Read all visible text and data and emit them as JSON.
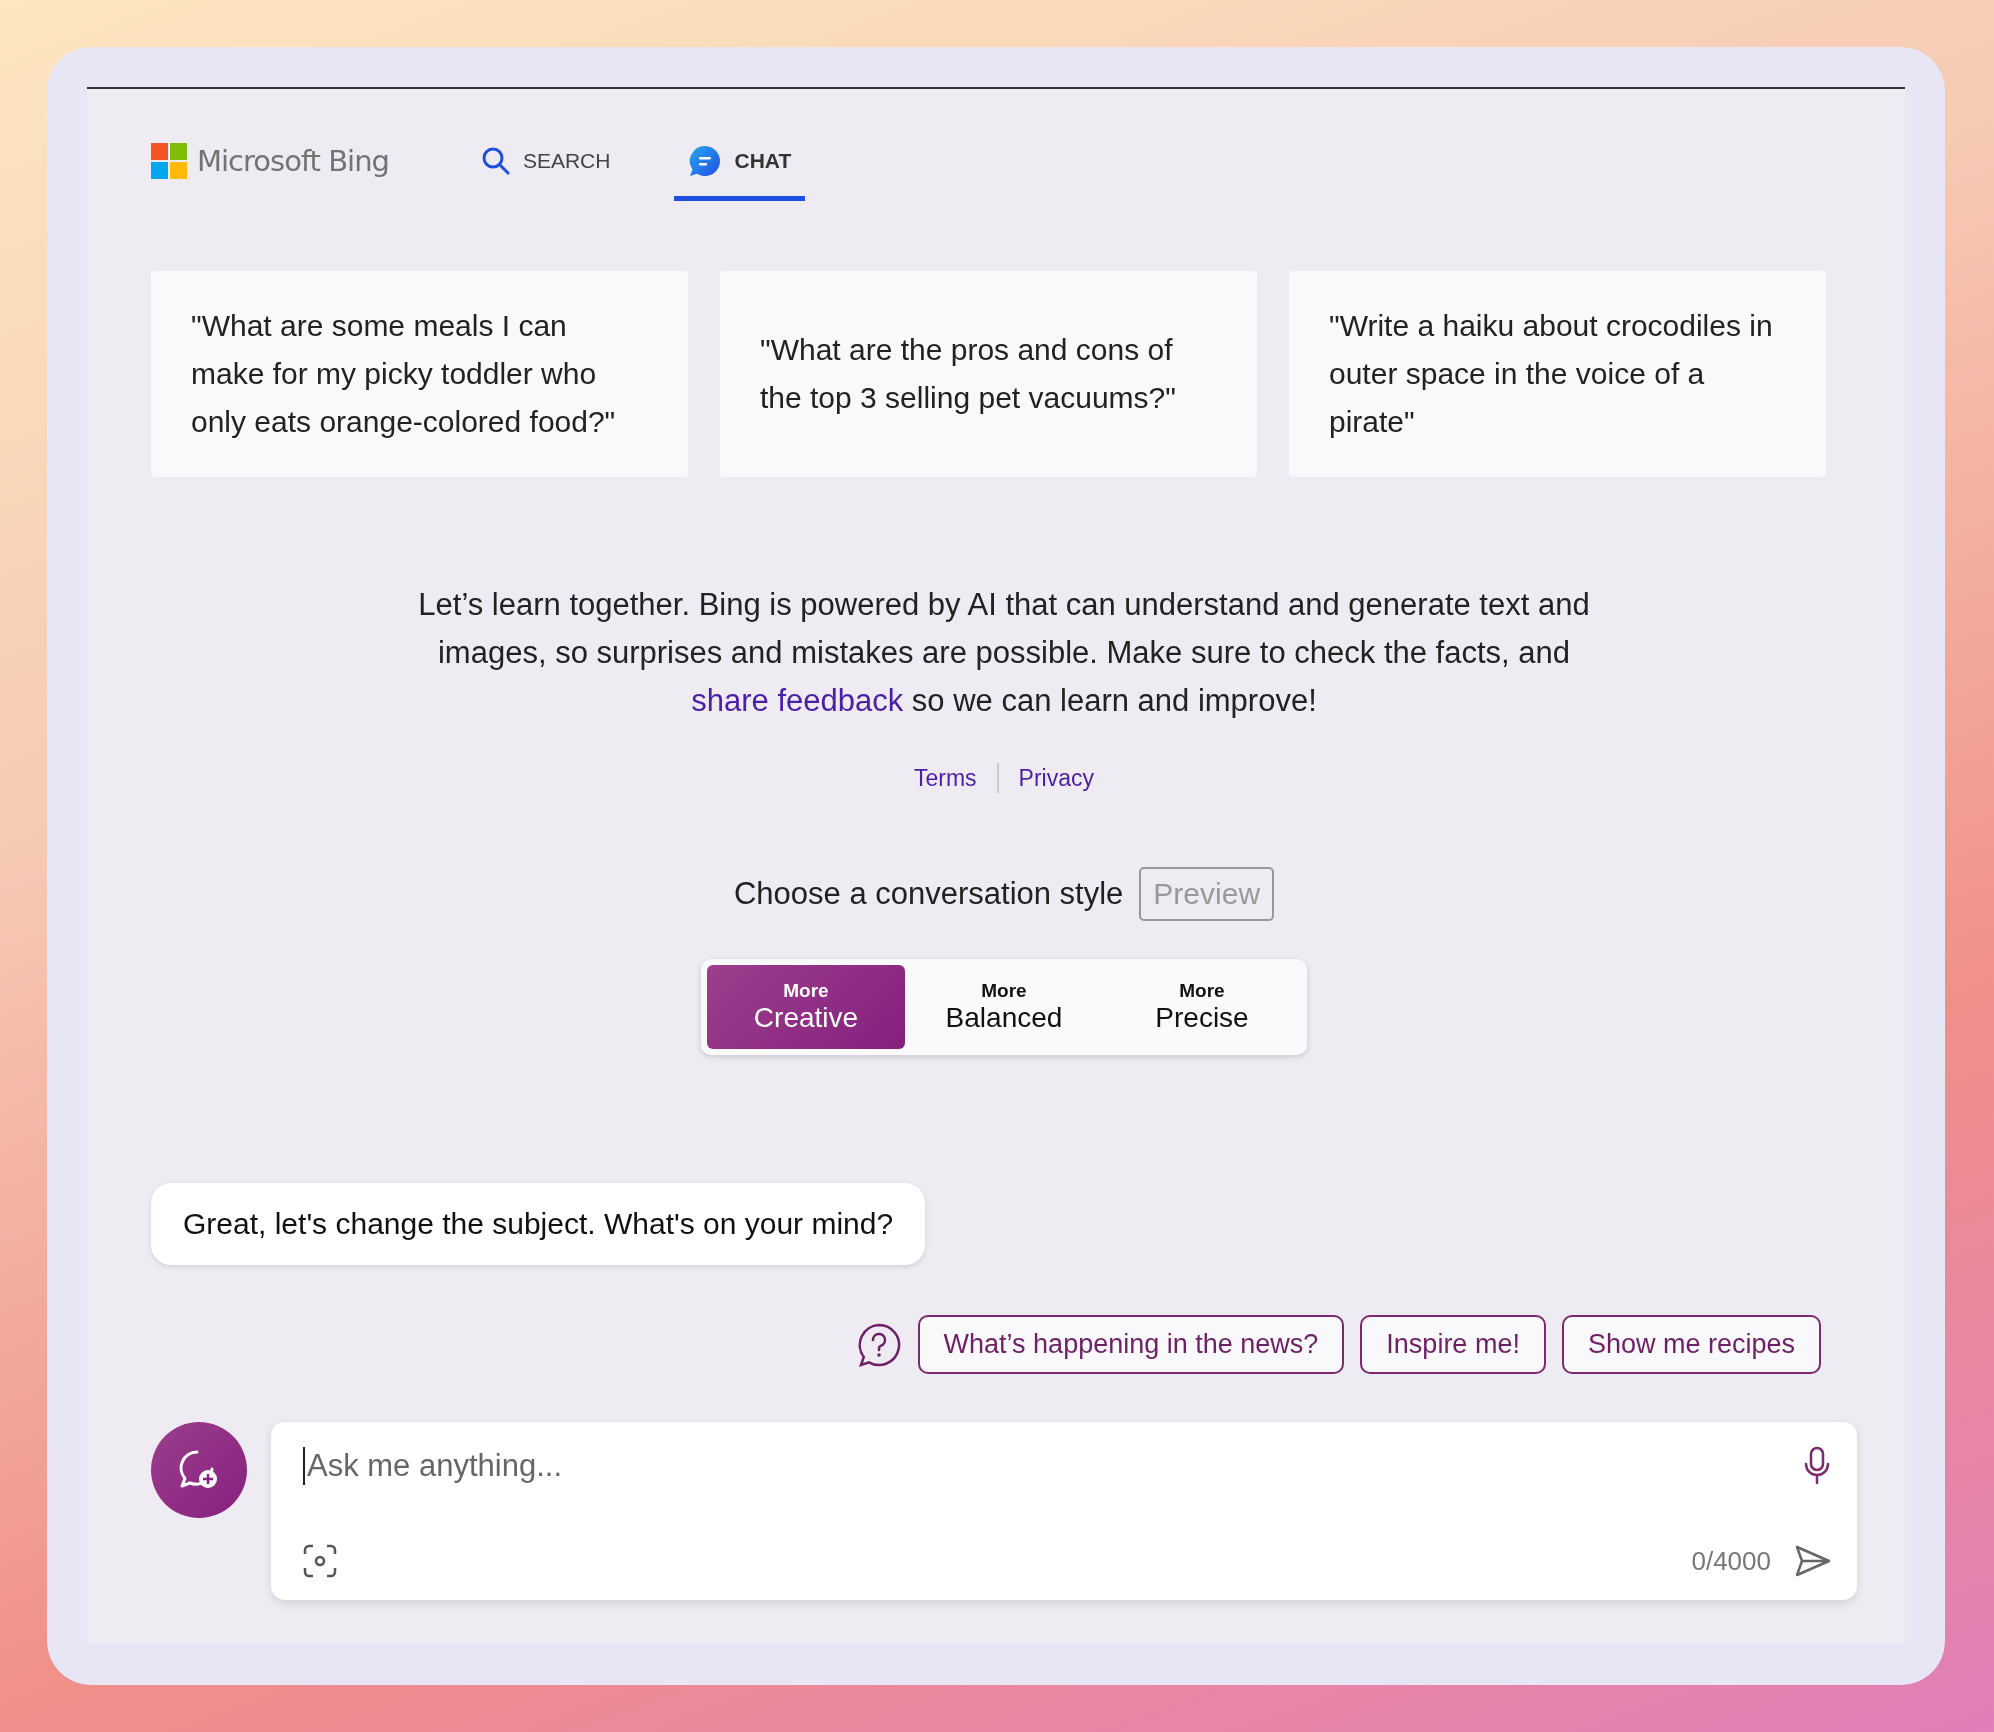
{
  "header": {
    "logo": "Microsoft Bing",
    "tabs": [
      {
        "label": "SEARCH",
        "kind": "search",
        "selected": false
      },
      {
        "label": "CHAT",
        "kind": "chat",
        "selected": true
      }
    ]
  },
  "example_prompts": [
    "\"What are some meals I can make for my picky toddler who only eats orange-colored food?\"",
    "\"What are the pros and cons of the top 3 selling pet vacuums?\"",
    "\"Write a haiku about crocodiles in outer space in the voice of a pirate\""
  ],
  "disclaimer": {
    "text": "Let’s learn together. Bing is powered by AI that can understand and generate text and images, so surprises and mistakes are possible. Make sure to check the facts, and",
    "link": "share feedback",
    "after": "so we can learn and improve!"
  },
  "legal_links": [
    "Terms",
    "Privacy"
  ],
  "conversation_style": {
    "label": "Choose a conversation style",
    "badge": "Preview",
    "options": [
      {
        "prefix": "More",
        "label": "Creative",
        "selected": true
      },
      {
        "prefix": "More",
        "label": "Balanced",
        "selected": false
      },
      {
        "prefix": "More",
        "label": "Precise",
        "selected": false
      }
    ]
  },
  "bot_message": "Great, let's change the subject. What's on your mind?",
  "suggestions": [
    "What’s happening in the news?",
    "Inspire me!",
    "Show me recipes"
  ],
  "input": {
    "placeholder": "Ask me anything...",
    "counter": "0/4000"
  }
}
